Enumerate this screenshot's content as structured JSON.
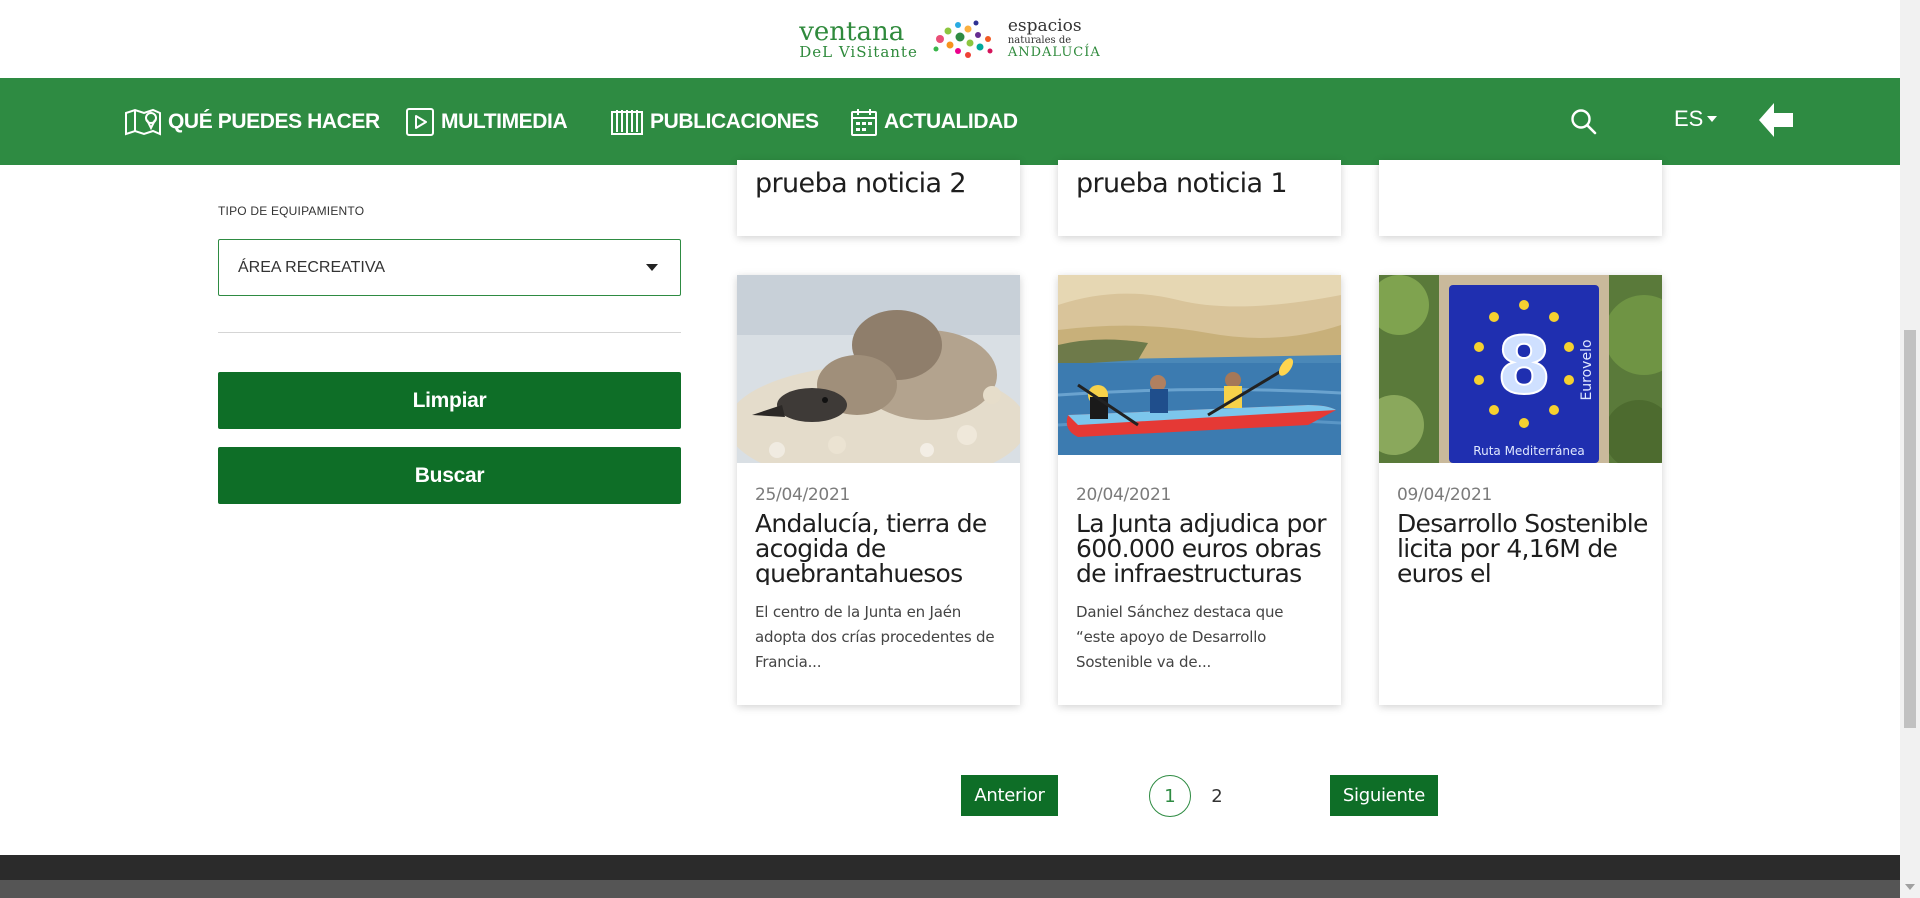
{
  "logo": {
    "line1": "ventana",
    "line2": "DeL ViSitante",
    "right1": "espacios",
    "right2": "naturales de",
    "right3": "ANDALUCÍA"
  },
  "nav": {
    "items": [
      {
        "label": "QUÉ PUEDES HACER",
        "icon": "map-pin-icon"
      },
      {
        "label": "MULTIMEDIA",
        "icon": "play-icon"
      },
      {
        "label": "PUBLICACIONES",
        "icon": "book-icon"
      },
      {
        "label": "ACTUALIDAD",
        "icon": "calendar-icon"
      }
    ],
    "language": "ES",
    "search_icon": "search-icon",
    "back_icon": "arrow-left-icon"
  },
  "filters": {
    "type_label": "TIPO DE EQUIPAMIENTO",
    "type_selected": "ÁREA RECREATIVA",
    "clear_label": "Limpiar",
    "search_label": "Buscar"
  },
  "top_cards": [
    {
      "title": "prueba noticia 2"
    },
    {
      "title": "prueba noticia 1"
    },
    {
      "title": ""
    }
  ],
  "cards": [
    {
      "date": "25/04/2021",
      "title": "Andalucía, tierra de acogida de quebrantahuesos",
      "excerpt": "El centro de la Junta en Jaén adopta dos crías procedentes de Francia..."
    },
    {
      "date": "20/04/2021",
      "title": "La Junta adjudica por 600.000 euros obras de infraestructuras",
      "excerpt": "Daniel Sánchez destaca que “este apoyo de Desarrollo Sostenible va de..."
    },
    {
      "date": "09/04/2021",
      "title": "Desarrollo Sostenible licita por 4,16M de euros el",
      "excerpt": ""
    }
  ],
  "image_text": {
    "eurovelo_number": "8",
    "eurovelo_word": "Eurovelo",
    "eurovelo_sub": "Ruta Mediterránea"
  },
  "pagination": {
    "prev_label": "Anterior",
    "pages": [
      "1",
      "2"
    ],
    "current_page": 1,
    "next_label": "Siguiente"
  },
  "colors": {
    "nav_green": "#2e8b42",
    "button_green": "#0e6e27",
    "footer_dark": "#2b2b2b"
  }
}
